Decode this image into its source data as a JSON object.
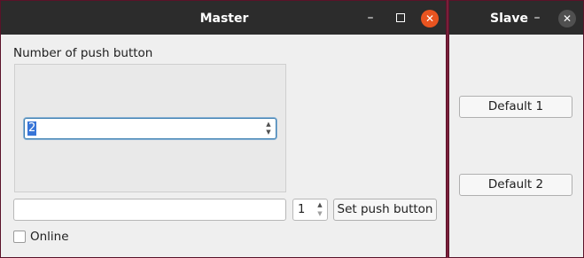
{
  "master": {
    "title": "Master",
    "minimize_glyph": "–",
    "close_glyph": "✕",
    "number_label": "Number of push button",
    "spin_value": "2",
    "text_value": "",
    "small_spin_value": "1",
    "set_button_label": "Set push button",
    "online_label": "Online"
  },
  "slave": {
    "title": "Slave",
    "minimize_glyph": "–",
    "close_glyph": "✕",
    "buttons": [
      {
        "label": "Default 1"
      },
      {
        "label": "Default 2"
      }
    ]
  },
  "icons": {
    "up_arrow": "▲",
    "down_arrow": "▼"
  },
  "colors": {
    "desktop": "#7a1f3a",
    "titlebar": "#2c2c2c",
    "close_accent": "#e95420",
    "selection": "#3875d7"
  }
}
